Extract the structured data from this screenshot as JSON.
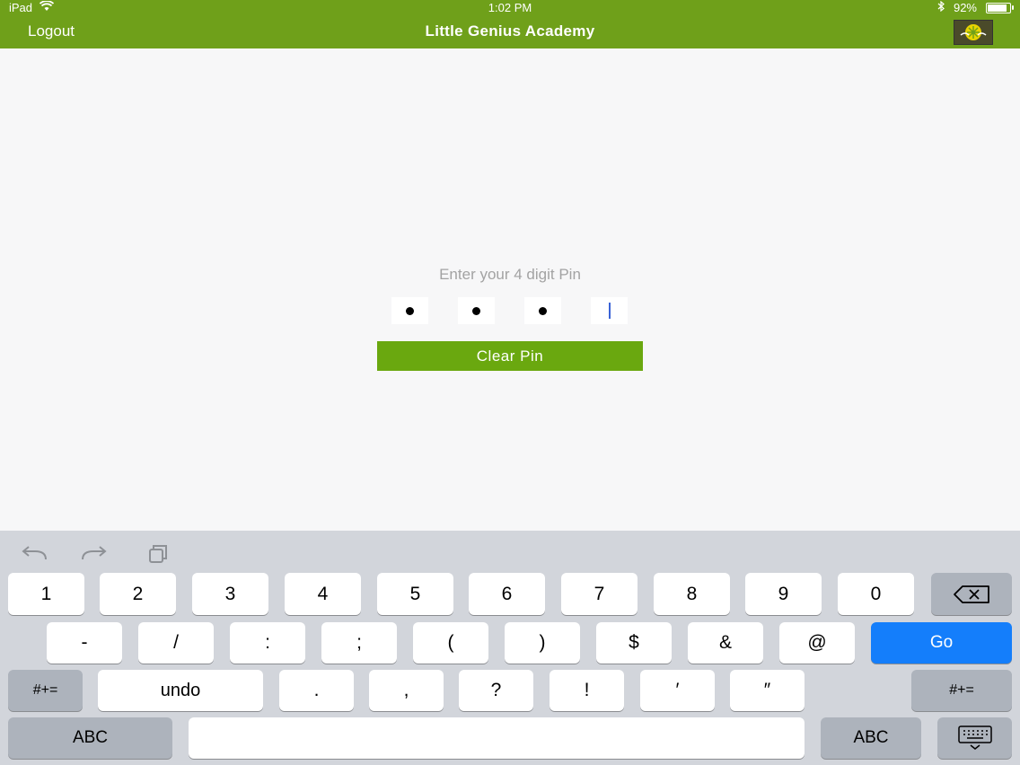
{
  "status": {
    "device": "iPad",
    "time": "1:02 PM",
    "battery": "92%"
  },
  "nav": {
    "logout": "Logout",
    "title": "Little Genius Academy"
  },
  "pin": {
    "label": "Enter your 4 digit Pin",
    "clear_label": "Clear Pin",
    "filled": 3,
    "total": 4
  },
  "keyboard": {
    "row1": [
      "1",
      "2",
      "3",
      "4",
      "5",
      "6",
      "7",
      "8",
      "9",
      "0"
    ],
    "row2": [
      "-",
      "/",
      ":",
      ";",
      "(",
      ")",
      "$",
      "&",
      "@"
    ],
    "go": "Go",
    "row3_left": "#+=",
    "undo": "undo",
    "row3": [
      ".",
      ",",
      "?",
      "!",
      "′",
      "″"
    ],
    "row3_right": "#+=",
    "abc": "ABC"
  },
  "colors": {
    "nav": "#6fa01a",
    "button": "#6aa80f",
    "go": "#147efb"
  }
}
